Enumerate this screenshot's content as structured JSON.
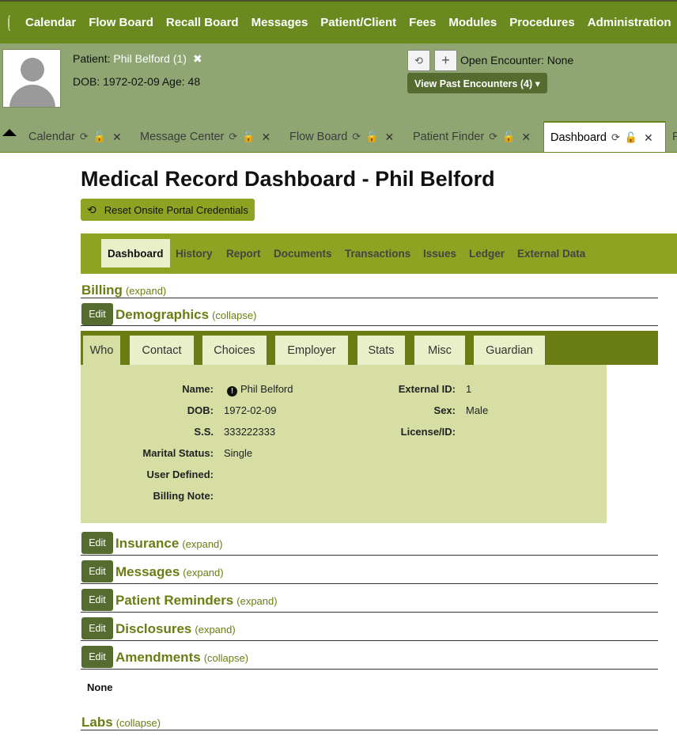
{
  "menu": {
    "items": [
      "Calendar",
      "Flow Board",
      "Recall Board",
      "Messages",
      "Patient/Client",
      "Fees",
      "Modules",
      "Procedures",
      "Administration"
    ]
  },
  "patient": {
    "label": "Patient:",
    "name": "Phil Belford (1)",
    "close": "✖",
    "dob_line": "DOB: 1972-02-09 Age: 48",
    "open_encounter": "Open Encounter: None",
    "history_icon": "history-icon",
    "add_icon": "plus-icon",
    "past_encounters": "View Past Encounters  (4) ▾"
  },
  "tabs": [
    {
      "label": "Calendar"
    },
    {
      "label": "Message Center"
    },
    {
      "label": "Flow Board"
    },
    {
      "label": "Patient Finder"
    },
    {
      "label": "Dashboard"
    },
    {
      "label": "P"
    }
  ],
  "tab_icons": {
    "refresh": "⟳",
    "lock": "🔓",
    "close": "✕"
  },
  "page": {
    "title": "Medical Record Dashboard - Phil Belford",
    "reset_button": "Reset Onsite Portal Credentials"
  },
  "nav": {
    "items": [
      "Dashboard",
      "History",
      "Report",
      "Documents",
      "Transactions",
      "Issues",
      "Ledger",
      "External Data"
    ]
  },
  "sections": {
    "billing": {
      "title": "Billing",
      "toggle": "(expand)"
    },
    "demographics": {
      "title": "Demographics",
      "toggle": "(collapse)",
      "edit": "Edit"
    },
    "insurance": {
      "title": "Insurance",
      "toggle": "(expand)",
      "edit": "Edit"
    },
    "messages": {
      "title": "Messages",
      "toggle": "(expand)",
      "edit": "Edit"
    },
    "reminders": {
      "title": "Patient Reminders",
      "toggle": "(expand)",
      "edit": "Edit"
    },
    "disclosures": {
      "title": "Disclosures",
      "toggle": "(expand)",
      "edit": "Edit"
    },
    "amendments": {
      "title": "Amendments",
      "toggle": "(collapse)",
      "edit": "Edit",
      "content": "None"
    },
    "labs": {
      "title": "Labs",
      "toggle": "(collapse)"
    }
  },
  "demo_tabs": [
    "Who",
    "Contact",
    "Choices",
    "Employer",
    "Stats",
    "Misc",
    "Guardian"
  ],
  "demographics": {
    "name_label": "Name:",
    "name_value": "Phil  Belford",
    "dob_label": "DOB:",
    "dob_value": "1972-02-09",
    "ss_label": "S.S.",
    "ss_value": "333222333",
    "marital_label": "Marital Status:",
    "marital_value": "Single",
    "user_defined_label": "User Defined:",
    "billing_note_label": "Billing Note:",
    "external_id_label": "External ID:",
    "external_id_value": "1",
    "sex_label": "Sex:",
    "sex_value": "Male",
    "license_label": "License/ID:"
  },
  "colors": {
    "menu_bg": "#6a8a1f",
    "header_bg": "#8fa673",
    "accent": "#8ea322",
    "dark_green": "#556b2f",
    "panel": "#d6dea3"
  }
}
